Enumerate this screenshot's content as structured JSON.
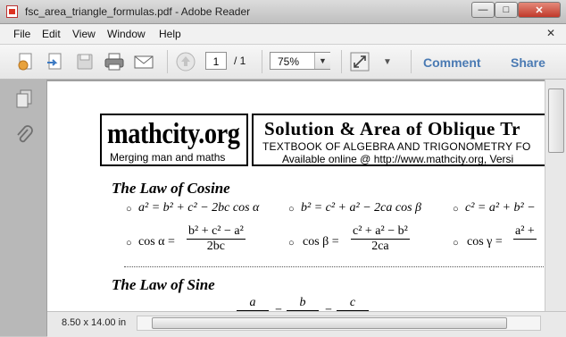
{
  "window": {
    "title": "fsc_area_triangle_formulas.pdf - Adobe Reader",
    "buttons": {
      "minimize": "—",
      "maximize": "□",
      "close": "✕"
    }
  },
  "menu": {
    "items": [
      "File",
      "Edit",
      "View",
      "Window",
      "Help"
    ],
    "close_glyph": "✕"
  },
  "toolbar": {
    "page_current": "1",
    "page_total": "/ 1",
    "zoom": "75%",
    "comment_label": "Comment",
    "share_label": "Share"
  },
  "status": {
    "page_size": "8.50 x 14.00 in"
  },
  "document": {
    "logo": "mathcity.org",
    "tagline": "Merging man and maths",
    "title": "Solution & Area of Oblique Tr",
    "book": "TEXTBOOK OF ALGEBRA AND TRIGONOMETRY FO",
    "available": "Available online @ http://www.mathcity.org,  Versi",
    "section_cosine": "The Law of Cosine",
    "cosine_eq1": "a² = b² + c² − 2bc cos α",
    "cosine_eq2": "b² = c² + a² − 2ca cos β",
    "cosine_eq3": "c² = a² + b² −",
    "cos_alpha_lhs": "cos α =",
    "cos_alpha_num": "b² + c² − a²",
    "cos_alpha_den": "2bc",
    "cos_beta_lhs": "cos β =",
    "cos_beta_num": "c² + a² − b²",
    "cos_beta_den": "2ca",
    "cos_gamma_lhs": "cos γ =",
    "cos_gamma_num": "a² +",
    "section_sine": "The Law of Sine",
    "sine_a": "a",
    "sine_b": "b",
    "sine_c": "c",
    "sine_eq": "=",
    "bullet": "○"
  }
}
